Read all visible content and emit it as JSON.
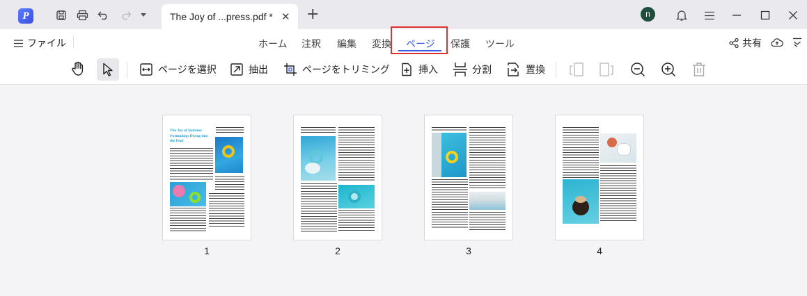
{
  "titlebar": {
    "document_tab_title": "The Joy of ...press.pdf *",
    "tab_close_glyph": "✕",
    "new_tab_glyph": "+",
    "user_initial": "n",
    "icons": [
      "app-logo",
      "save-icon",
      "print-icon",
      "undo-icon",
      "redo-icon",
      "dropdown-icon",
      "bell-icon",
      "hamburger-icon",
      "minimize-icon",
      "maximize-icon",
      "close-icon"
    ]
  },
  "menubar": {
    "file_label": "ファイル",
    "items": [
      {
        "label": "ホーム"
      },
      {
        "label": "注釈"
      },
      {
        "label": "編集"
      },
      {
        "label": "変換"
      },
      {
        "label": "ページ"
      },
      {
        "label": "保護"
      },
      {
        "label": "ツール"
      }
    ],
    "active_item": "ページ",
    "share_label": "共有",
    "accent_color": "#3a56e6",
    "highlight_color": "#e0332f"
  },
  "toolbar": {
    "select_page": "ページを選択",
    "extract": "抽出",
    "crop_page": "ページをトリミング",
    "insert": "挿入",
    "split": "分割",
    "replace": "置換"
  },
  "pages": [
    {
      "number": "1",
      "heading": "The Joy of Summer Swimmings Diving into the Pool"
    },
    {
      "number": "2"
    },
    {
      "number": "3"
    },
    {
      "number": "4"
    }
  ]
}
